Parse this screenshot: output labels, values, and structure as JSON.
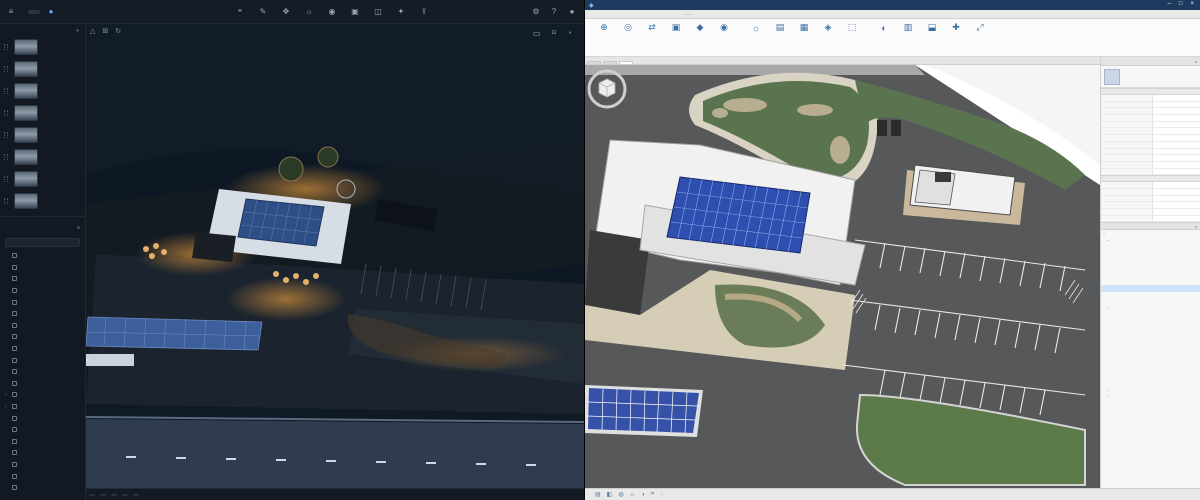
{
  "left": {
    "app_name": "",
    "mode_label": "",
    "views_header": "",
    "views": [
      {
        "name": "",
        "count": ""
      },
      {
        "name": "",
        "count": ""
      },
      {
        "name": "",
        "count": ""
      },
      {
        "name": "",
        "count": ""
      },
      {
        "name": "",
        "count": ""
      },
      {
        "name": "",
        "count": ""
      },
      {
        "name": "",
        "count": ""
      },
      {
        "name": "",
        "count": ""
      }
    ],
    "tabs": [
      "",
      ""
    ],
    "search_placeholder": "",
    "layers": [
      "",
      "",
      "",
      "",
      "",
      "",
      "",
      "",
      "",
      "",
      "",
      "",
      "",
      "",
      "",
      "",
      "",
      "",
      "",
      "",
      ""
    ],
    "viewport_buttons": [
      "",
      ""
    ],
    "camera_label": "",
    "status_chips": [
      "",
      "",
      "",
      "",
      ""
    ],
    "colors": {
      "bg": "#0a1420",
      "panel": "#121923",
      "accent": "#6ea0ff",
      "solar": "#3d5f9b"
    }
  },
  "right": {
    "title": "",
    "ribbon_tabs": [
      "",
      "",
      "",
      "",
      "",
      "",
      "",
      "",
      "",
      ""
    ],
    "ribbon_buttons": [
      "",
      "",
      "",
      "",
      "",
      "",
      "",
      "",
      "",
      "",
      "",
      "",
      "",
      "",
      "",
      ""
    ],
    "doc_tabs": [
      "",
      "",
      ""
    ],
    "properties_title": "",
    "properties_type": "",
    "property_sections": [
      {
        "title": "",
        "rows": [
          [
            "",
            ""
          ],
          [
            "",
            ""
          ],
          [
            "",
            ""
          ],
          [
            "",
            ""
          ],
          [
            "",
            ""
          ],
          [
            "",
            ""
          ],
          [
            "",
            ""
          ],
          [
            "",
            ""
          ],
          [
            "",
            ""
          ],
          [
            "",
            ""
          ],
          [
            "",
            ""
          ],
          [
            "",
            ""
          ]
        ]
      },
      {
        "title": "",
        "rows": [
          [
            "",
            ""
          ],
          [
            "",
            ""
          ],
          [
            "",
            ""
          ],
          [
            "",
            ""
          ],
          [
            "",
            ""
          ],
          [
            "",
            ""
          ]
        ]
      }
    ],
    "browser_title": "",
    "browser_items": [
      "",
      "",
      "",
      "",
      "",
      "",
      "",
      "",
      "",
      "",
      "",
      "",
      "",
      "",
      "",
      "",
      "",
      "",
      "",
      "",
      "",
      "",
      "",
      "",
      "",
      "",
      "",
      ""
    ],
    "status_text": "",
    "colors": {
      "grass": "#4f6b47",
      "asphalt": "#515355",
      "roof": "#e8e8e8",
      "solar": "#3552a8"
    }
  }
}
